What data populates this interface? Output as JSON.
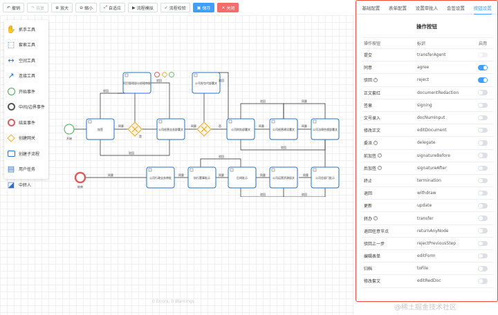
{
  "toolbar": {
    "buttons": [
      {
        "label": "撤销",
        "icon": "undo-icon",
        "state": "normal"
      },
      {
        "label": "恢复",
        "icon": "redo-icon",
        "state": "disabled"
      },
      {
        "label": "放大",
        "icon": "zoom-in-icon",
        "state": "normal"
      },
      {
        "label": "缩小",
        "icon": "zoom-out-icon",
        "state": "normal"
      },
      {
        "label": "自适应",
        "icon": "fit-icon",
        "state": "normal"
      },
      {
        "label": "流程模拟",
        "icon": "play-icon",
        "state": "normal"
      },
      {
        "label": "流程校验",
        "icon": "check-icon",
        "state": "normal"
      },
      {
        "label": "保存",
        "icon": "save-icon",
        "state": "primary"
      },
      {
        "label": "关闭",
        "icon": "close-icon",
        "state": "danger"
      }
    ]
  },
  "palette": {
    "items": [
      {
        "label": "抓手工具",
        "icon": "hand-icon"
      },
      {
        "label": "套索工具",
        "icon": "lasso-icon"
      },
      {
        "label": "空间工具",
        "icon": "space-icon"
      },
      {
        "label": "连接工具",
        "icon": "connect-icon"
      },
      {
        "label": "开始事件",
        "icon": "start-event-icon"
      },
      {
        "label": "中间/边界事件",
        "icon": "intermediate-event-icon"
      },
      {
        "label": "结束事件",
        "icon": "end-event-icon"
      },
      {
        "label": "创建网关",
        "icon": "gateway-icon"
      },
      {
        "label": "创建子流程",
        "icon": "subprocess-icon"
      },
      {
        "label": "用户任务",
        "icon": "user-task-icon"
      },
      {
        "label": "中转人",
        "icon": "transfer-person-icon"
      }
    ]
  },
  "diagram": {
    "start_label": "开始",
    "end_label": "结束",
    "tasks_top": [
      "加签",
      "公司经营业务部署文",
      "公司财务部署文",
      "公司经营建设署文",
      "公司法律合规部署文"
    ],
    "tasks_float": [
      "项目管理部分经理审批",
      "公司发包代部署文"
    ],
    "tasks_bottom": [
      "公司行政业务审批",
      "执行董事批示",
      "后线批示",
      "公司运营资源部文",
      "公司总部门批示"
    ],
    "edge_labels": {
      "agree": "同意",
      "reject": "驳回",
      "yes": "是",
      "no": "否"
    }
  },
  "warnings": "0 Errors, 0 Warnings",
  "panel": {
    "tabs": [
      "基础配置",
      "表单配置",
      "设置审批人",
      "会签设置",
      "按钮设置"
    ],
    "active_tab": 4,
    "title": "操作按钮",
    "columns": [
      "操作按钮",
      "标识",
      "启用"
    ],
    "rows": [
      {
        "name": "提交",
        "key": "transferAgent",
        "help": false,
        "state": "disabled"
      },
      {
        "name": "同意",
        "key": "agree",
        "help": false,
        "state": "on"
      },
      {
        "name": "驳回",
        "key": "reject",
        "help": true,
        "state": "on"
      },
      {
        "name": "正文套红",
        "key": "documentRedaction",
        "help": false,
        "state": "off"
      },
      {
        "name": "签章",
        "key": "signing",
        "help": false,
        "state": "off"
      },
      {
        "name": "文号录入",
        "key": "docNumInput",
        "help": false,
        "state": "off"
      },
      {
        "name": "修改正文",
        "key": "editDocument",
        "help": false,
        "state": "off"
      },
      {
        "name": "委派",
        "key": "delegate",
        "help": true,
        "state": "off"
      },
      {
        "name": "前加签",
        "key": "signatureBefore",
        "help": true,
        "state": "off"
      },
      {
        "name": "后加签",
        "key": "signatureAfter",
        "help": true,
        "state": "off"
      },
      {
        "name": "终止",
        "key": "termination",
        "help": false,
        "state": "off"
      },
      {
        "name": "退回",
        "key": "withdraw",
        "help": false,
        "state": "off"
      },
      {
        "name": "更新",
        "key": "update",
        "help": false,
        "state": "off"
      },
      {
        "name": "转办",
        "key": "transfer",
        "help": true,
        "state": "off"
      },
      {
        "name": "退回任意节点",
        "key": "returnAnyNode",
        "help": false,
        "state": "off"
      },
      {
        "name": "驳回上一步",
        "key": "rejectPreviousStep",
        "help": false,
        "state": "off"
      },
      {
        "name": "编辑表单",
        "key": "editForm",
        "help": false,
        "state": "off"
      },
      {
        "name": "归档",
        "key": "toFile",
        "help": false,
        "state": "off"
      },
      {
        "name": "修改套文",
        "key": "editRedDoc",
        "help": false,
        "state": "off"
      }
    ]
  },
  "watermark": "@稀土掘金技术社区",
  "colors": {
    "accent": "#409eff",
    "danger": "#f56c6c",
    "panel_border": "#e84c3d",
    "task_border": "#1f6fd1",
    "gateway": "#f5a623"
  }
}
